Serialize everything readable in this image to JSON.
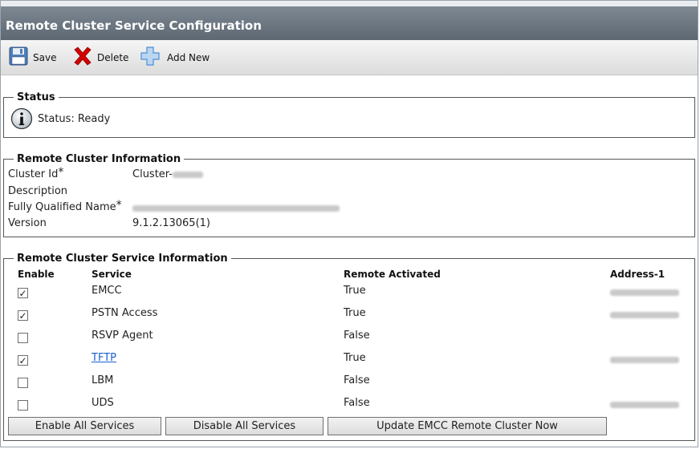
{
  "window": {
    "title": "Remote Cluster Service Configuration"
  },
  "toolbar": {
    "save_label": "Save",
    "delete_label": "Delete",
    "add_new_label": "Add New"
  },
  "status": {
    "legend": "Status",
    "text": "Status: Ready"
  },
  "cluster_info": {
    "legend": "Remote Cluster Information",
    "cluster_id_label": "Cluster Id",
    "cluster_id_prefix": "Cluster-",
    "description_label": "Description",
    "fqdn_label": "Fully Qualified Name",
    "version_label": "Version",
    "version_value": "9.1.2.13065(1)",
    "required_mark": "*"
  },
  "service_info": {
    "legend": "Remote Cluster Service Information",
    "columns": {
      "enable": "Enable",
      "service": "Service",
      "remote_activated": "Remote Activated",
      "address": "Address-1"
    },
    "rows": [
      {
        "service": "EMCC",
        "checked": true,
        "remote_activated": "True",
        "has_address": true,
        "link": false
      },
      {
        "service": "PSTN Access",
        "checked": true,
        "remote_activated": "True",
        "has_address": true,
        "link": false
      },
      {
        "service": "RSVP Agent",
        "checked": false,
        "remote_activated": "False",
        "has_address": false,
        "link": false
      },
      {
        "service": "TFTP",
        "checked": true,
        "remote_activated": "True",
        "has_address": true,
        "link": true
      },
      {
        "service": "LBM",
        "checked": false,
        "remote_activated": "False",
        "has_address": false,
        "link": false
      },
      {
        "service": "UDS",
        "checked": false,
        "remote_activated": "False",
        "has_address": true,
        "link": false
      }
    ]
  },
  "buttons": {
    "enable_all": "Enable All Services",
    "disable_all": "Disable All Services",
    "update_now": "Update EMCC Remote Cluster Now"
  },
  "colors": {
    "titlebar": "#6b7681",
    "link": "#1a5fcf",
    "delete_icon": "#d40000",
    "add_icon": "#4a8fd6"
  }
}
